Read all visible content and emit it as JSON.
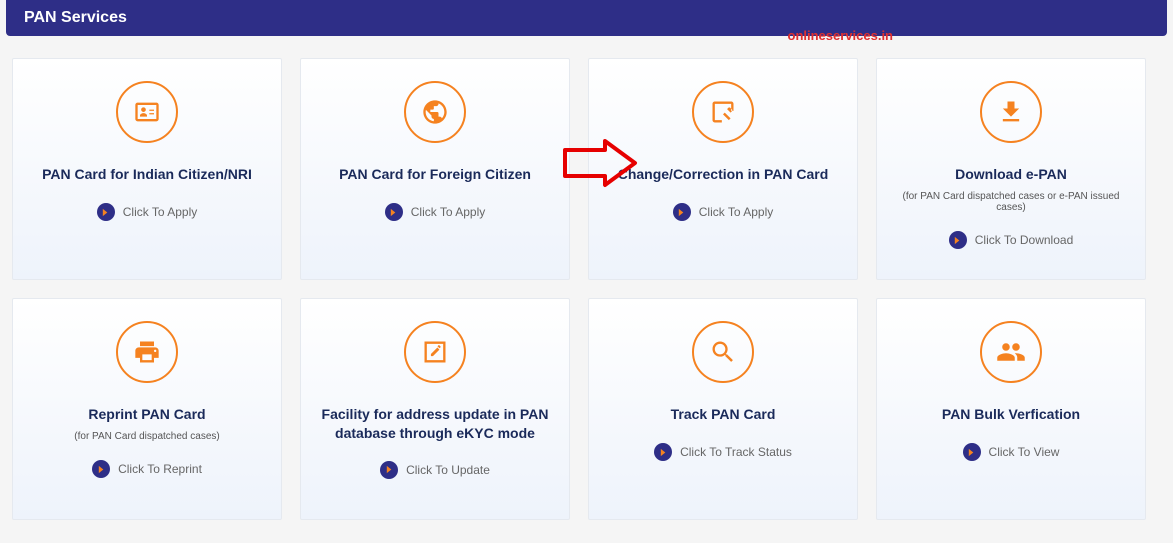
{
  "header": {
    "title": "PAN Services"
  },
  "watermark": "onlineservices.in",
  "cards": [
    {
      "title": "PAN Card for Indian Citizen/NRI",
      "subtitle": "",
      "action": "Click To Apply",
      "icon": "id-card"
    },
    {
      "title": "PAN Card for Foreign Citizen",
      "subtitle": "",
      "action": "Click To Apply",
      "icon": "globe"
    },
    {
      "title": "Change/Correction in PAN Card",
      "subtitle": "",
      "action": "Click To Apply",
      "icon": "edit-square"
    },
    {
      "title": "Download e-PAN",
      "subtitle": "(for PAN Card dispatched cases or e-PAN issued cases)",
      "action": "Click To Download",
      "icon": "download"
    },
    {
      "title": "Reprint PAN Card",
      "subtitle": "(for PAN Card dispatched cases)",
      "action": "Click To Reprint",
      "icon": "print"
    },
    {
      "title": "Facility for address update in PAN database through eKYC mode",
      "subtitle": "",
      "action": "Click To Update",
      "icon": "pencil-square"
    },
    {
      "title": "Track PAN Card",
      "subtitle": "",
      "action": "Click To Track Status",
      "icon": "search"
    },
    {
      "title": "PAN Bulk Verfication",
      "subtitle": "",
      "action": "Click To View",
      "icon": "users"
    }
  ]
}
